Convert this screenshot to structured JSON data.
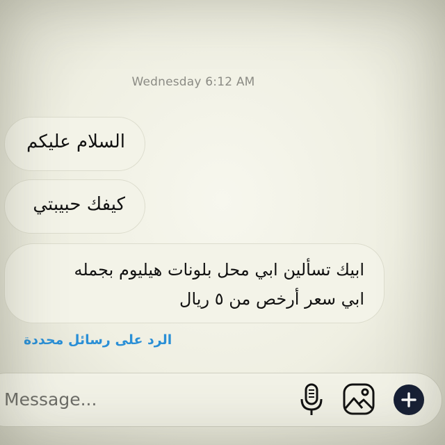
{
  "thread": {
    "timestamp": "Wednesday 6:12 AM",
    "messages": [
      {
        "text": "السلام عليكم"
      },
      {
        "text": "كيفك حبيبتي"
      },
      {
        "lines": [
          "ابيك تسألين ابي محل بلونات هيليوم بجمله",
          "ابي سعر أرخص من ٥ ريال"
        ]
      }
    ],
    "reply_link": "الرد على رسائل محددة"
  },
  "composer": {
    "placeholder": "Message...",
    "icons": [
      "microphone-icon",
      "photo-icon",
      "plus-icon"
    ]
  },
  "colors": {
    "link": "#2a8fd6",
    "plus_button": "#131c33"
  }
}
